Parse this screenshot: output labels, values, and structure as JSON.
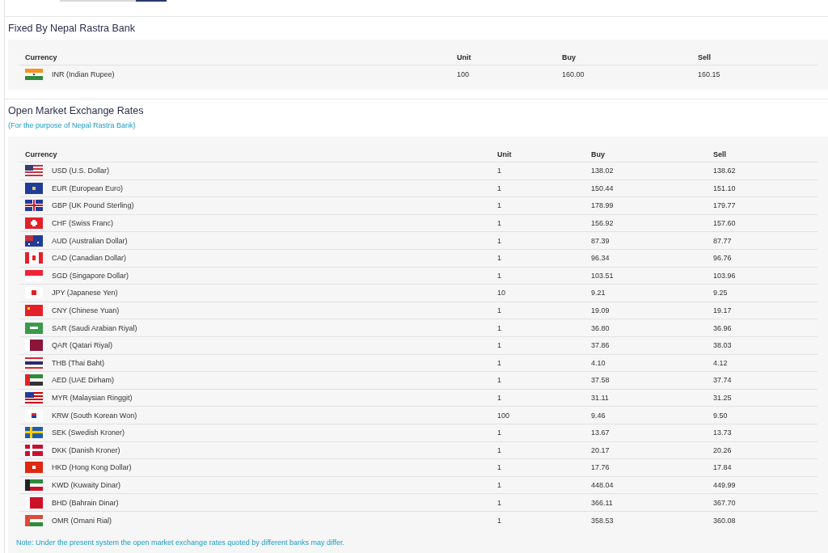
{
  "fixed": {
    "title": "Fixed By Nepal Rastra Bank",
    "columns": [
      "Currency",
      "Unit",
      "Buy",
      "Sell"
    ],
    "rows": [
      {
        "currency": "INR (Indian Rupee)",
        "unit": "100",
        "buy": "160.00",
        "sell": "160.15"
      }
    ]
  },
  "open_market": {
    "title": "Open Market Exchange Rates",
    "subtitle": "(For the purpose of Nepal Rastra Bank)",
    "columns": [
      "Currency",
      "Unit",
      "Buy",
      "Sell"
    ],
    "rows": [
      {
        "currency": "USD (U.S. Dollar)",
        "unit": "1",
        "buy": "138.02",
        "sell": "138.62"
      },
      {
        "currency": "EUR (European Euro)",
        "unit": "1",
        "buy": "150.44",
        "sell": "151.10"
      },
      {
        "currency": "GBP (UK Pound Sterling)",
        "unit": "1",
        "buy": "178.99",
        "sell": "179.77"
      },
      {
        "currency": "CHF (Swiss Franc)",
        "unit": "1",
        "buy": "156.92",
        "sell": "157.60"
      },
      {
        "currency": "AUD (Australian Dollar)",
        "unit": "1",
        "buy": "87.39",
        "sell": "87.77"
      },
      {
        "currency": "CAD (Canadian Dollar)",
        "unit": "1",
        "buy": "96.34",
        "sell": "96.76"
      },
      {
        "currency": "SGD (Singapore Dollar)",
        "unit": "1",
        "buy": "103.51",
        "sell": "103.96"
      },
      {
        "currency": "JPY (Japanese Yen)",
        "unit": "10",
        "buy": "9.21",
        "sell": "9.25"
      },
      {
        "currency": "CNY (Chinese Yuan)",
        "unit": "1",
        "buy": "19.09",
        "sell": "19.17"
      },
      {
        "currency": "SAR (Saudi Arabian Riyal)",
        "unit": "1",
        "buy": "36.80",
        "sell": "36.96"
      },
      {
        "currency": "QAR (Qatari Riyal)",
        "unit": "1",
        "buy": "37.86",
        "sell": "38.03"
      },
      {
        "currency": "THB (Thai Baht)",
        "unit": "1",
        "buy": "4.10",
        "sell": "4.12"
      },
      {
        "currency": "AED (UAE Dirham)",
        "unit": "1",
        "buy": "37.58",
        "sell": "37.74"
      },
      {
        "currency": "MYR (Malaysian Ringgit)",
        "unit": "1",
        "buy": "31.11",
        "sell": "31.25"
      },
      {
        "currency": "KRW (South Korean Won)",
        "unit": "100",
        "buy": "9.46",
        "sell": "9.50"
      },
      {
        "currency": "SEK (Swedish Kroner)",
        "unit": "1",
        "buy": "13.67",
        "sell": "13.73"
      },
      {
        "currency": "DKK (Danish Kroner)",
        "unit": "1",
        "buy": "20.17",
        "sell": "20.26"
      },
      {
        "currency": "HKD (Hong Kong Dollar)",
        "unit": "1",
        "buy": "17.76",
        "sell": "17.84"
      },
      {
        "currency": "KWD (Kuwaity Dinar)",
        "unit": "1",
        "buy": "448.04",
        "sell": "449.99"
      },
      {
        "currency": "BHD (Bahrain Dinar)",
        "unit": "1",
        "buy": "366.11",
        "sell": "367.70"
      },
      {
        "currency": "OMR (Omani Rial)",
        "unit": "1",
        "buy": "358.53",
        "sell": "360.08"
      }
    ],
    "note": "Note: Under the present system the open market exchange rates quoted by different banks may differ."
  }
}
